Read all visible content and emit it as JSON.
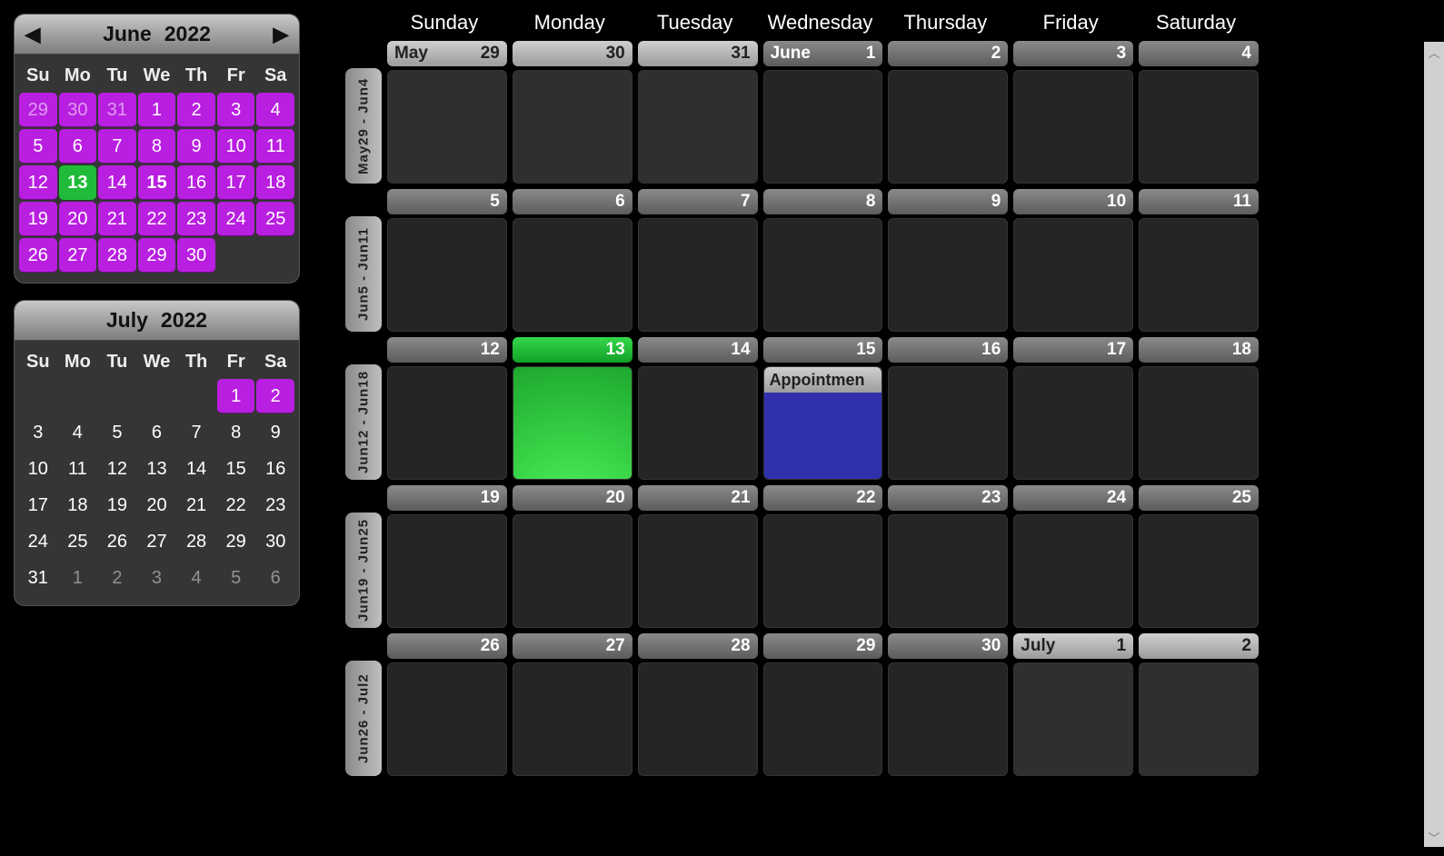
{
  "mini1": {
    "month": "June",
    "year": "2022",
    "has_nav": true,
    "dow": [
      "Su",
      "Mo",
      "Tu",
      "We",
      "Th",
      "Fr",
      "Sa"
    ],
    "cells": [
      {
        "d": "29",
        "c": "range dim"
      },
      {
        "d": "30",
        "c": "range dim"
      },
      {
        "d": "31",
        "c": "range dim"
      },
      {
        "d": "1",
        "c": "range"
      },
      {
        "d": "2",
        "c": "range"
      },
      {
        "d": "3",
        "c": "range"
      },
      {
        "d": "4",
        "c": "range"
      },
      {
        "d": "5",
        "c": "range"
      },
      {
        "d": "6",
        "c": "range"
      },
      {
        "d": "7",
        "c": "range"
      },
      {
        "d": "8",
        "c": "range"
      },
      {
        "d": "9",
        "c": "range"
      },
      {
        "d": "10",
        "c": "range"
      },
      {
        "d": "11",
        "c": "range"
      },
      {
        "d": "12",
        "c": "range"
      },
      {
        "d": "13",
        "c": "today"
      },
      {
        "d": "14",
        "c": "range"
      },
      {
        "d": "15",
        "c": "range bold"
      },
      {
        "d": "16",
        "c": "range"
      },
      {
        "d": "17",
        "c": "range"
      },
      {
        "d": "18",
        "c": "range"
      },
      {
        "d": "19",
        "c": "range"
      },
      {
        "d": "20",
        "c": "range"
      },
      {
        "d": "21",
        "c": "range"
      },
      {
        "d": "22",
        "c": "range"
      },
      {
        "d": "23",
        "c": "range"
      },
      {
        "d": "24",
        "c": "range"
      },
      {
        "d": "25",
        "c": "range"
      },
      {
        "d": "26",
        "c": "range"
      },
      {
        "d": "27",
        "c": "range"
      },
      {
        "d": "28",
        "c": "range"
      },
      {
        "d": "29",
        "c": "range"
      },
      {
        "d": "30",
        "c": "range"
      },
      {
        "d": "",
        "c": "plain"
      },
      {
        "d": "",
        "c": "plain"
      }
    ]
  },
  "mini2": {
    "month": "July",
    "year": "2022",
    "has_nav": false,
    "dow": [
      "Su",
      "Mo",
      "Tu",
      "We",
      "Th",
      "Fr",
      "Sa"
    ],
    "cells": [
      {
        "d": "",
        "c": "plain"
      },
      {
        "d": "",
        "c": "plain"
      },
      {
        "d": "",
        "c": "plain"
      },
      {
        "d": "",
        "c": "plain"
      },
      {
        "d": "",
        "c": "plain"
      },
      {
        "d": "1",
        "c": "range"
      },
      {
        "d": "2",
        "c": "range"
      },
      {
        "d": "3",
        "c": "plain"
      },
      {
        "d": "4",
        "c": "plain"
      },
      {
        "d": "5",
        "c": "plain"
      },
      {
        "d": "6",
        "c": "plain"
      },
      {
        "d": "7",
        "c": "plain"
      },
      {
        "d": "8",
        "c": "plain"
      },
      {
        "d": "9",
        "c": "plain"
      },
      {
        "d": "10",
        "c": "plain"
      },
      {
        "d": "11",
        "c": "plain"
      },
      {
        "d": "12",
        "c": "plain"
      },
      {
        "d": "13",
        "c": "plain"
      },
      {
        "d": "14",
        "c": "plain"
      },
      {
        "d": "15",
        "c": "plain"
      },
      {
        "d": "16",
        "c": "plain"
      },
      {
        "d": "17",
        "c": "plain"
      },
      {
        "d": "18",
        "c": "plain"
      },
      {
        "d": "19",
        "c": "plain"
      },
      {
        "d": "20",
        "c": "plain"
      },
      {
        "d": "21",
        "c": "plain"
      },
      {
        "d": "22",
        "c": "plain"
      },
      {
        "d": "23",
        "c": "plain"
      },
      {
        "d": "24",
        "c": "plain"
      },
      {
        "d": "25",
        "c": "plain"
      },
      {
        "d": "26",
        "c": "plain"
      },
      {
        "d": "27",
        "c": "plain"
      },
      {
        "d": "28",
        "c": "plain"
      },
      {
        "d": "29",
        "c": "plain"
      },
      {
        "d": "30",
        "c": "plain"
      },
      {
        "d": "31",
        "c": "plain"
      },
      {
        "d": "1",
        "c": "plain dim"
      },
      {
        "d": "2",
        "c": "plain dim"
      },
      {
        "d": "3",
        "c": "plain dim"
      },
      {
        "d": "4",
        "c": "plain dim"
      },
      {
        "d": "5",
        "c": "plain dim"
      },
      {
        "d": "6",
        "c": "plain dim"
      }
    ]
  },
  "main": {
    "weekdays": [
      "Sunday",
      "Monday",
      "Tuesday",
      "Wednesday",
      "Thursday",
      "Friday",
      "Saturday"
    ],
    "weeks": [
      {
        "label": "May29 - Jun4",
        "days": [
          {
            "num": "29",
            "month": "May",
            "pill": "light",
            "body": "other"
          },
          {
            "num": "30",
            "pill": "light",
            "body": "other"
          },
          {
            "num": "31",
            "pill": "light",
            "body": "other"
          },
          {
            "num": "1",
            "month": "June",
            "pill": "",
            "body": ""
          },
          {
            "num": "2",
            "pill": "",
            "body": ""
          },
          {
            "num": "3",
            "pill": "",
            "body": ""
          },
          {
            "num": "4",
            "pill": "",
            "body": ""
          }
        ]
      },
      {
        "label": "Jun5 - Jun11",
        "days": [
          {
            "num": "5"
          },
          {
            "num": "6"
          },
          {
            "num": "7"
          },
          {
            "num": "8"
          },
          {
            "num": "9"
          },
          {
            "num": "10"
          },
          {
            "num": "11"
          }
        ]
      },
      {
        "label": "Jun12 - Jun18",
        "days": [
          {
            "num": "12"
          },
          {
            "num": "13",
            "pill": "today",
            "body": "today-body"
          },
          {
            "num": "14"
          },
          {
            "num": "15",
            "appt": "Appointmen",
            "appt_color": "#3030ac"
          },
          {
            "num": "16"
          },
          {
            "num": "17"
          },
          {
            "num": "18"
          }
        ]
      },
      {
        "label": "Jun19 - Jun25",
        "days": [
          {
            "num": "19"
          },
          {
            "num": "20"
          },
          {
            "num": "21"
          },
          {
            "num": "22"
          },
          {
            "num": "23"
          },
          {
            "num": "24"
          },
          {
            "num": "25"
          }
        ]
      },
      {
        "label": "Jun26 - Jul2",
        "days": [
          {
            "num": "26"
          },
          {
            "num": "27"
          },
          {
            "num": "28"
          },
          {
            "num": "29"
          },
          {
            "num": "30"
          },
          {
            "num": "1",
            "month": "July",
            "pill": "light",
            "body": "other"
          },
          {
            "num": "2",
            "pill": "light",
            "body": "other"
          }
        ]
      }
    ]
  }
}
